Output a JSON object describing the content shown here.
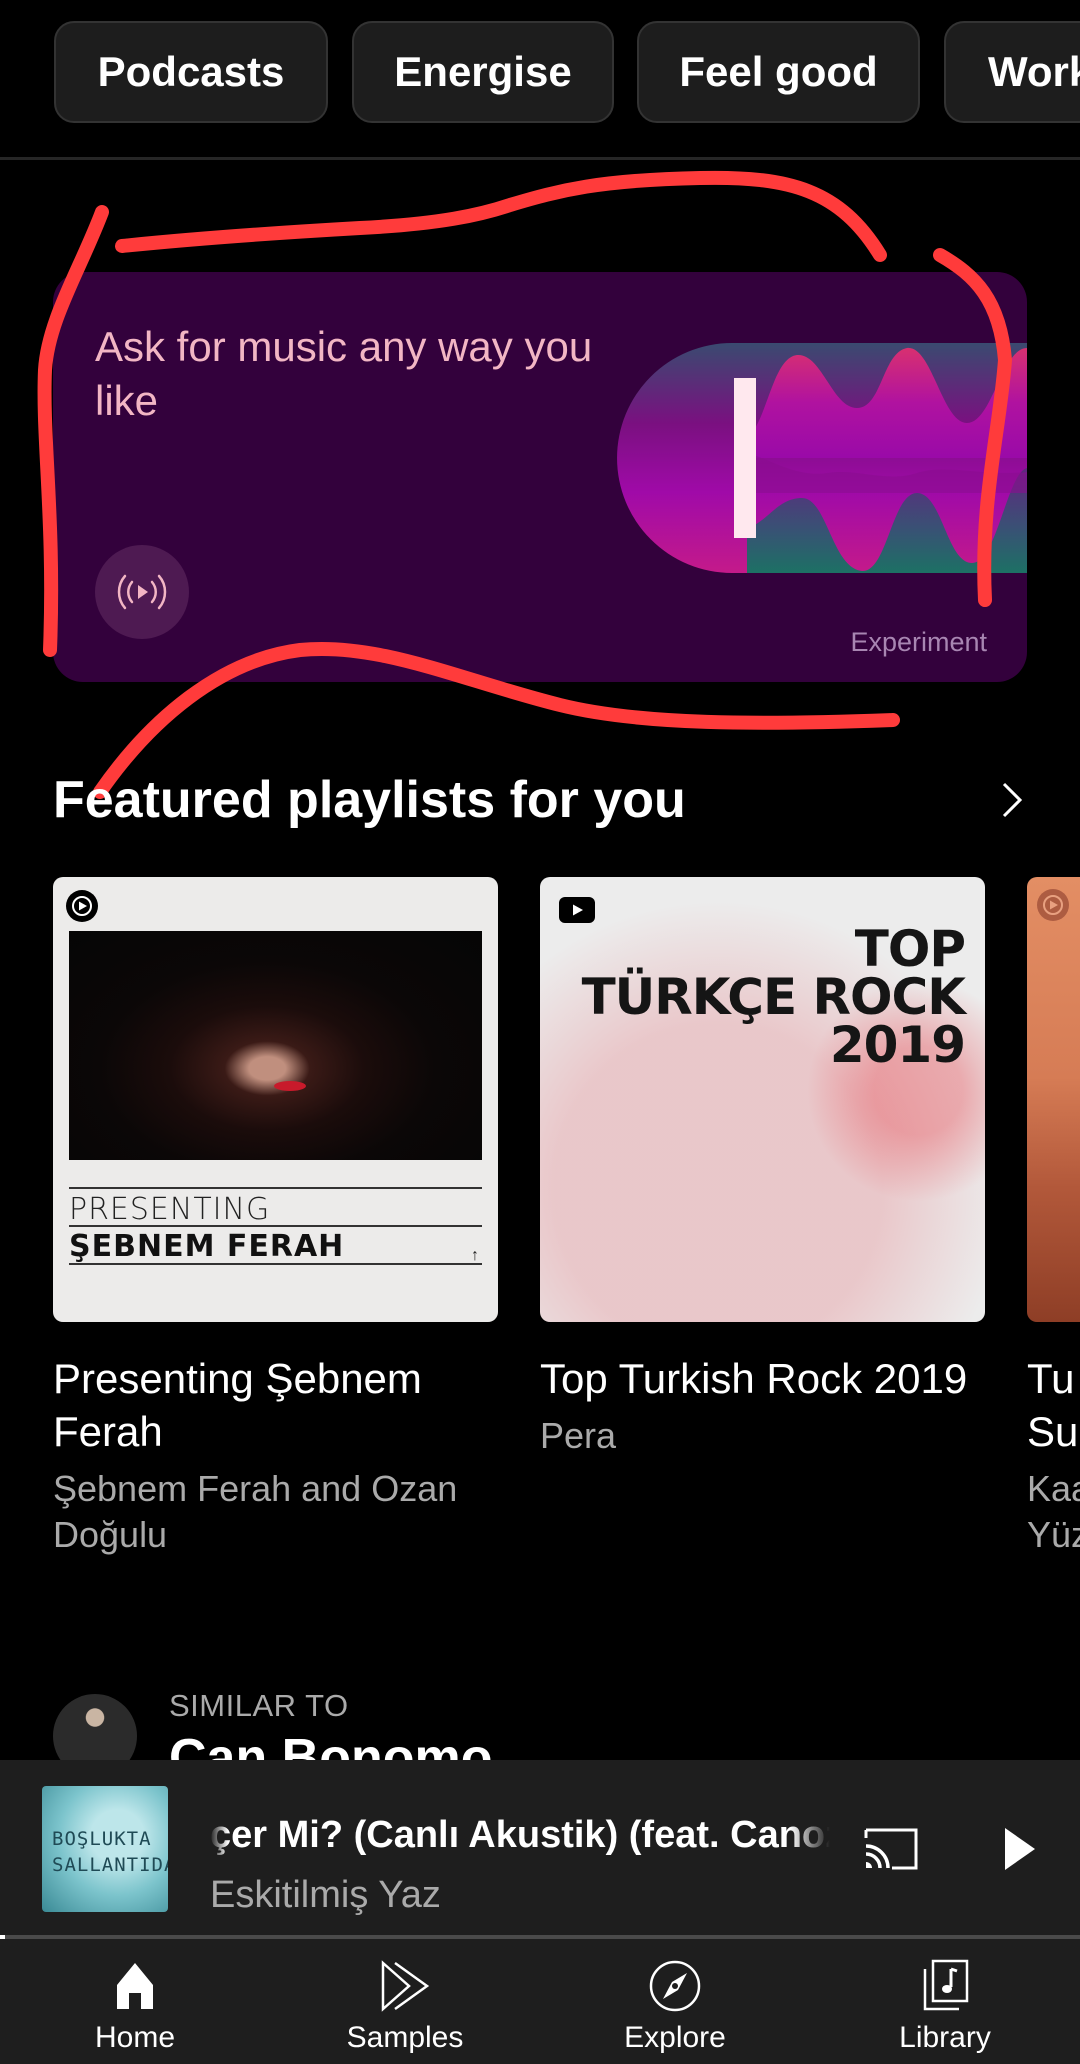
{
  "chips": [
    {
      "label": "Podcasts"
    },
    {
      "label": "Energise"
    },
    {
      "label": "Feel good"
    },
    {
      "label": "Work"
    }
  ],
  "experiment_card": {
    "title": "Ask for music any way you like",
    "badge": "Experiment",
    "icon": "radio-play-icon",
    "accent_color": "#f2b6c4",
    "background_color": "#33013c"
  },
  "featured": {
    "title": "Featured playlists for you",
    "more_icon": "chevron-right-icon",
    "playlists": [
      {
        "title": "Presenting Şebnem Ferah",
        "subtitle": "Şebnem Ferah and Ozan Doğulu",
        "thumb_text_top": "PRESENTING",
        "thumb_text_name": "ŞEBNEM FERAH"
      },
      {
        "title": "Top Turkish Rock 2019",
        "subtitle": "Pera",
        "thumb_text_1": "TOP",
        "thumb_text_2": "TÜRKÇE ROCK",
        "thumb_text_3": "2019"
      },
      {
        "title": "Tu Su",
        "subtitle": "Kaa Yüz"
      }
    ]
  },
  "similar_to": {
    "label": "SIMILAR TO",
    "artist": "Can Bonomo"
  },
  "mini_player": {
    "title": "çer Mi? (Canlı Akustik) (feat. Canozan)",
    "subtitle": "Eskitilmiş Yaz",
    "art_text": "BOŞLUKTA SALLANTIDA",
    "progress": 0.005,
    "cast_icon": "cast-icon",
    "play_icon": "play-icon"
  },
  "nav": [
    {
      "label": "Home",
      "icon": "home-icon",
      "active": true
    },
    {
      "label": "Samples",
      "icon": "samples-icon",
      "active": false
    },
    {
      "label": "Explore",
      "icon": "compass-icon",
      "active": false
    },
    {
      "label": "Library",
      "icon": "library-icon",
      "active": false
    }
  ]
}
